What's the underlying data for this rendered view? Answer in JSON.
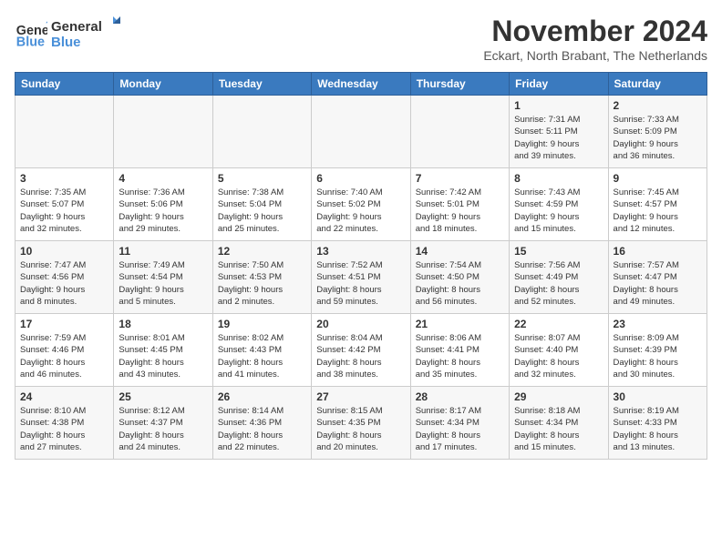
{
  "logo": {
    "line1": "General",
    "line2": "Blue"
  },
  "title": "November 2024",
  "subtitle": "Eckart, North Brabant, The Netherlands",
  "weekdays": [
    "Sunday",
    "Monday",
    "Tuesday",
    "Wednesday",
    "Thursday",
    "Friday",
    "Saturday"
  ],
  "weeks": [
    [
      {
        "day": "",
        "info": ""
      },
      {
        "day": "",
        "info": ""
      },
      {
        "day": "",
        "info": ""
      },
      {
        "day": "",
        "info": ""
      },
      {
        "day": "",
        "info": ""
      },
      {
        "day": "1",
        "info": "Sunrise: 7:31 AM\nSunset: 5:11 PM\nDaylight: 9 hours\nand 39 minutes."
      },
      {
        "day": "2",
        "info": "Sunrise: 7:33 AM\nSunset: 5:09 PM\nDaylight: 9 hours\nand 36 minutes."
      }
    ],
    [
      {
        "day": "3",
        "info": "Sunrise: 7:35 AM\nSunset: 5:07 PM\nDaylight: 9 hours\nand 32 minutes."
      },
      {
        "day": "4",
        "info": "Sunrise: 7:36 AM\nSunset: 5:06 PM\nDaylight: 9 hours\nand 29 minutes."
      },
      {
        "day": "5",
        "info": "Sunrise: 7:38 AM\nSunset: 5:04 PM\nDaylight: 9 hours\nand 25 minutes."
      },
      {
        "day": "6",
        "info": "Sunrise: 7:40 AM\nSunset: 5:02 PM\nDaylight: 9 hours\nand 22 minutes."
      },
      {
        "day": "7",
        "info": "Sunrise: 7:42 AM\nSunset: 5:01 PM\nDaylight: 9 hours\nand 18 minutes."
      },
      {
        "day": "8",
        "info": "Sunrise: 7:43 AM\nSunset: 4:59 PM\nDaylight: 9 hours\nand 15 minutes."
      },
      {
        "day": "9",
        "info": "Sunrise: 7:45 AM\nSunset: 4:57 PM\nDaylight: 9 hours\nand 12 minutes."
      }
    ],
    [
      {
        "day": "10",
        "info": "Sunrise: 7:47 AM\nSunset: 4:56 PM\nDaylight: 9 hours\nand 8 minutes."
      },
      {
        "day": "11",
        "info": "Sunrise: 7:49 AM\nSunset: 4:54 PM\nDaylight: 9 hours\nand 5 minutes."
      },
      {
        "day": "12",
        "info": "Sunrise: 7:50 AM\nSunset: 4:53 PM\nDaylight: 9 hours\nand 2 minutes."
      },
      {
        "day": "13",
        "info": "Sunrise: 7:52 AM\nSunset: 4:51 PM\nDaylight: 8 hours\nand 59 minutes."
      },
      {
        "day": "14",
        "info": "Sunrise: 7:54 AM\nSunset: 4:50 PM\nDaylight: 8 hours\nand 56 minutes."
      },
      {
        "day": "15",
        "info": "Sunrise: 7:56 AM\nSunset: 4:49 PM\nDaylight: 8 hours\nand 52 minutes."
      },
      {
        "day": "16",
        "info": "Sunrise: 7:57 AM\nSunset: 4:47 PM\nDaylight: 8 hours\nand 49 minutes."
      }
    ],
    [
      {
        "day": "17",
        "info": "Sunrise: 7:59 AM\nSunset: 4:46 PM\nDaylight: 8 hours\nand 46 minutes."
      },
      {
        "day": "18",
        "info": "Sunrise: 8:01 AM\nSunset: 4:45 PM\nDaylight: 8 hours\nand 43 minutes."
      },
      {
        "day": "19",
        "info": "Sunrise: 8:02 AM\nSunset: 4:43 PM\nDaylight: 8 hours\nand 41 minutes."
      },
      {
        "day": "20",
        "info": "Sunrise: 8:04 AM\nSunset: 4:42 PM\nDaylight: 8 hours\nand 38 minutes."
      },
      {
        "day": "21",
        "info": "Sunrise: 8:06 AM\nSunset: 4:41 PM\nDaylight: 8 hours\nand 35 minutes."
      },
      {
        "day": "22",
        "info": "Sunrise: 8:07 AM\nSunset: 4:40 PM\nDaylight: 8 hours\nand 32 minutes."
      },
      {
        "day": "23",
        "info": "Sunrise: 8:09 AM\nSunset: 4:39 PM\nDaylight: 8 hours\nand 30 minutes."
      }
    ],
    [
      {
        "day": "24",
        "info": "Sunrise: 8:10 AM\nSunset: 4:38 PM\nDaylight: 8 hours\nand 27 minutes."
      },
      {
        "day": "25",
        "info": "Sunrise: 8:12 AM\nSunset: 4:37 PM\nDaylight: 8 hours\nand 24 minutes."
      },
      {
        "day": "26",
        "info": "Sunrise: 8:14 AM\nSunset: 4:36 PM\nDaylight: 8 hours\nand 22 minutes."
      },
      {
        "day": "27",
        "info": "Sunrise: 8:15 AM\nSunset: 4:35 PM\nDaylight: 8 hours\nand 20 minutes."
      },
      {
        "day": "28",
        "info": "Sunrise: 8:17 AM\nSunset: 4:34 PM\nDaylight: 8 hours\nand 17 minutes."
      },
      {
        "day": "29",
        "info": "Sunrise: 8:18 AM\nSunset: 4:34 PM\nDaylight: 8 hours\nand 15 minutes."
      },
      {
        "day": "30",
        "info": "Sunrise: 8:19 AM\nSunset: 4:33 PM\nDaylight: 8 hours\nand 13 minutes."
      }
    ]
  ]
}
